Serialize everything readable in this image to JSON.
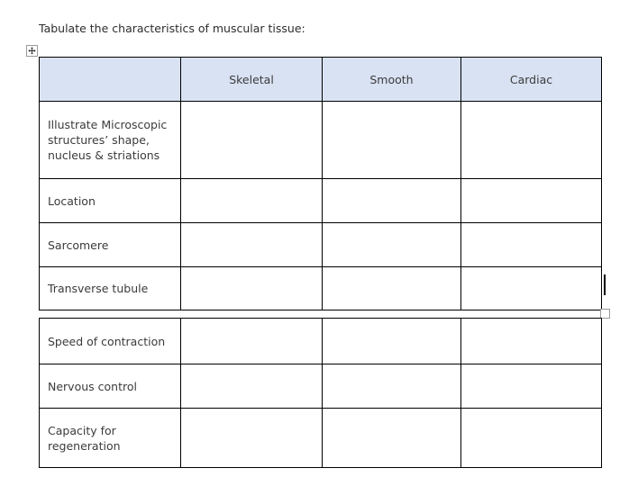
{
  "document": {
    "prompt": "Tabulate the characteristics of muscular tissue:"
  },
  "icons": {
    "table_move_handle": "move-cross-icon",
    "table_resize_handle": "resize-corner-icon",
    "column_resize_indicator": "column-resize-bar-icon"
  },
  "colors": {
    "header_fill": "#D9E2F3",
    "border": "#000000",
    "text": "#3B3B3B",
    "handle_border": "#9A9A9A",
    "page_background": "#FFFFFF"
  },
  "table": {
    "columns": [
      {
        "key": "characteristic",
        "label": ""
      },
      {
        "key": "skeletal",
        "label": "Skeletal"
      },
      {
        "key": "smooth",
        "label": "Smooth"
      },
      {
        "key": "cardiac",
        "label": "Cardiac"
      }
    ],
    "part_one_rows": [
      {
        "label_line_1": "Illustrate Microscopic",
        "label_line_2": "structures’ shape,",
        "label_line_3": "nucleus & striations",
        "skeletal": "",
        "smooth": "",
        "cardiac": ""
      },
      {
        "label_line_1": "Location",
        "skeletal": "",
        "smooth": "",
        "cardiac": ""
      },
      {
        "label_line_1": "Sarcomere",
        "skeletal": "",
        "smooth": "",
        "cardiac": ""
      },
      {
        "label_line_1": "Transverse tubule",
        "skeletal": "",
        "smooth": "",
        "cardiac": ""
      }
    ],
    "part_two_rows": [
      {
        "label_line_1": "Speed of contraction",
        "skeletal": "",
        "smooth": "",
        "cardiac": ""
      },
      {
        "label_line_1": "Nervous control",
        "skeletal": "",
        "smooth": "",
        "cardiac": ""
      },
      {
        "label_line_1": "Capacity for",
        "label_line_2": "regeneration",
        "skeletal": "",
        "smooth": "",
        "cardiac": ""
      }
    ]
  }
}
